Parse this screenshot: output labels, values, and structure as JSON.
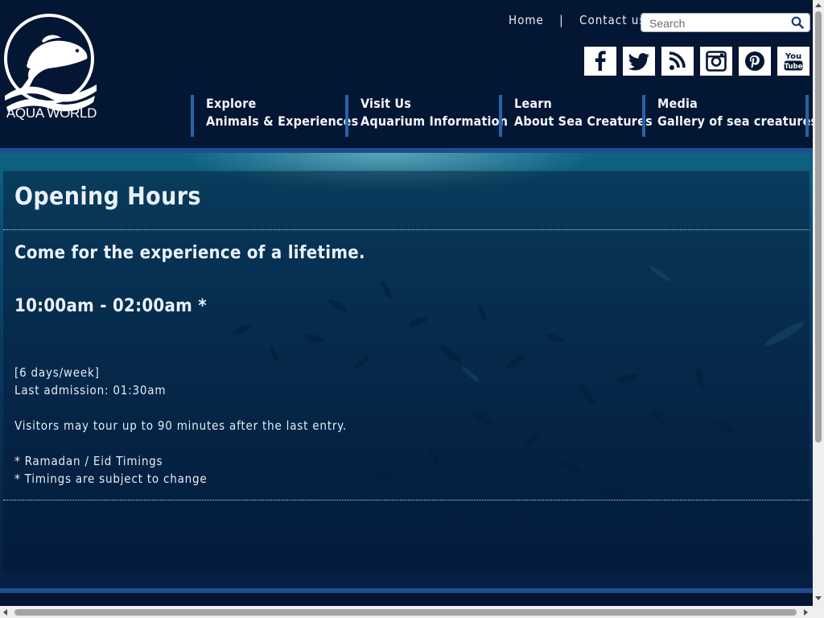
{
  "brand": {
    "name": "AQUA WORLD"
  },
  "toplinks": {
    "home": "Home",
    "separator": "|",
    "contact": "Contact us"
  },
  "search": {
    "placeholder": "Search",
    "icon": "search-icon"
  },
  "social": [
    {
      "name": "facebook-icon"
    },
    {
      "name": "twitter-icon"
    },
    {
      "name": "rss-icon"
    },
    {
      "name": "instagram-icon"
    },
    {
      "name": "pinterest-icon"
    },
    {
      "name": "youtube-icon"
    }
  ],
  "nav": [
    {
      "title": "Explore",
      "subtitle": "Animals & Experiences"
    },
    {
      "title": "Visit Us",
      "subtitle": "Aquarium Information"
    },
    {
      "title": "Learn",
      "subtitle": "About Sea Creatures"
    },
    {
      "title": "Media",
      "subtitle": "Gallery of sea creatures"
    }
  ],
  "page": {
    "title": "Opening Hours",
    "tagline": "Come for the experience of a lifetime.",
    "hours": "10:00am - 02:00am *",
    "days": "[6 days/week]",
    "last_admission": "Last admission: 01:30am",
    "tour_note": "Visitors may tour up to 90 minutes after the last entry.",
    "note_ramadan": "* Ramadan / Eid Timings",
    "note_change": "* Timings are subject to change"
  },
  "colors": {
    "header_bg": "#031633",
    "accent": "#2a62a8",
    "text": "#ffffff"
  }
}
